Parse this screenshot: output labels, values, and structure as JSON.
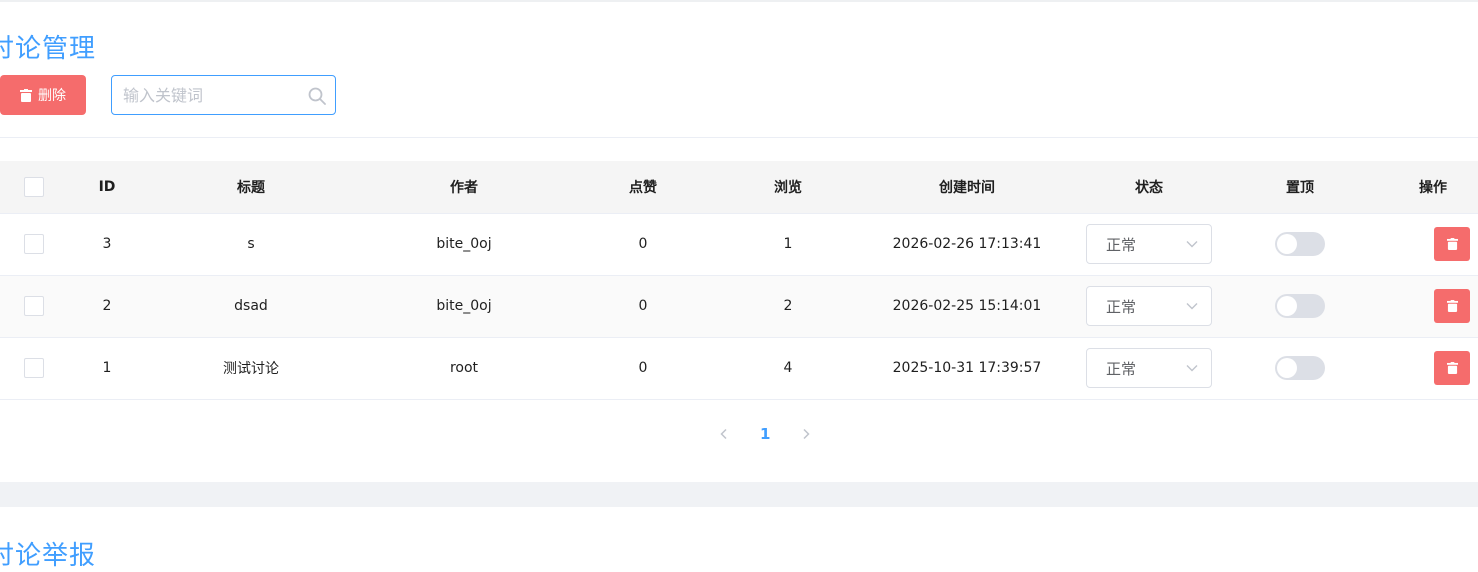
{
  "discussion_panel": {
    "title": "讨论管理",
    "delete_button": "删除",
    "search": {
      "placeholder": "输入关键词",
      "value": ""
    }
  },
  "table": {
    "columns": [
      "ID",
      "标题",
      "作者",
      "点赞",
      "浏览",
      "创建时间",
      "状态",
      "置顶",
      "操作"
    ],
    "rows": [
      {
        "id": "3",
        "title": "s",
        "author": "bite_0oj",
        "likes": "0",
        "views": "1",
        "created": "2026-02-26 17:13:41",
        "status": "正常",
        "pinned": false
      },
      {
        "id": "2",
        "title": "dsad",
        "author": "bite_0oj",
        "likes": "0",
        "views": "2",
        "created": "2026-02-25 15:14:01",
        "status": "正常",
        "pinned": false
      },
      {
        "id": "1",
        "title": "测试讨论",
        "author": "root",
        "likes": "0",
        "views": "4",
        "created": "2025-10-31 17:39:57",
        "status": "正常",
        "pinned": false
      }
    ]
  },
  "pagination": {
    "current_page": "1"
  },
  "report_panel": {
    "title": "讨论举报"
  },
  "colors": {
    "accent": "#409eff",
    "danger": "#f56c6c",
    "switch_off": "#dcdfe6"
  }
}
